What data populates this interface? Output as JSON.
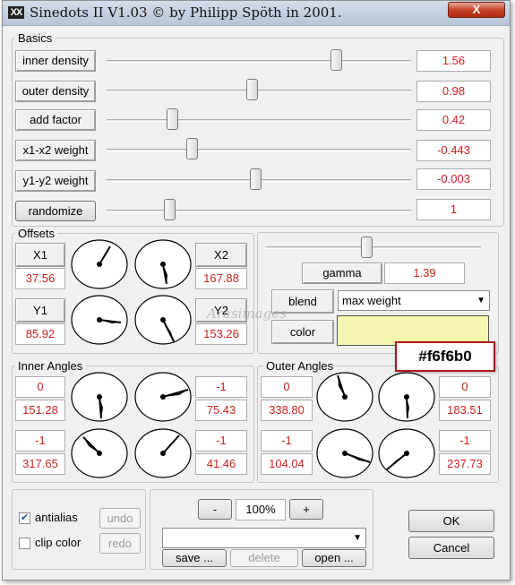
{
  "window": {
    "title": "Sinedots II V1.03 © by Philipp Spöth in 2001.",
    "close_label": "X",
    "icon_glyph": "XX"
  },
  "basics": {
    "group_label": "Basics",
    "rows": [
      {
        "label": "inner density",
        "value": "1.56",
        "slider": 0.82
      },
      {
        "label": "outer density",
        "value": "0.98",
        "slider": 0.55
      },
      {
        "label": "add factor",
        "value": "0.42",
        "slider": 0.23
      },
      {
        "label": "x1-x2 weight",
        "value": "-0.443",
        "slider": 0.3
      },
      {
        "label": "y1-y2 weight",
        "value": "-0.003",
        "slider": 0.53
      },
      {
        "label": "randomize",
        "value": "1",
        "slider": 0.22
      }
    ]
  },
  "offsets": {
    "group_label": "Offsets",
    "x1": {
      "label": "X1",
      "value": "37.56"
    },
    "x2": {
      "label": "X2",
      "value": "167.88"
    },
    "y1": {
      "label": "Y1",
      "value": "85.92"
    },
    "y2": {
      "label": "Y2",
      "value": "153.26"
    }
  },
  "gamma": {
    "label": "gamma",
    "value": "1.39",
    "slider": 0.46
  },
  "blend": {
    "label": "blend",
    "selected": "max weight"
  },
  "color": {
    "label": "color",
    "hex": "#f6f6b0",
    "tooltip": "#f6f6b0"
  },
  "inner_angles": {
    "group_label": "Inner Angles",
    "rows": [
      {
        "left_top": "0",
        "left_bottom": "151.28",
        "right_top": "-1",
        "right_bottom": "75.43"
      },
      {
        "left_top": "-1",
        "left_bottom": "317.65",
        "right_top": "-1",
        "right_bottom": "41.46"
      }
    ]
  },
  "outer_angles": {
    "group_label": "Outer Angles",
    "rows": [
      {
        "left_top": "0",
        "left_bottom": "338.80",
        "right_top": "0",
        "right_bottom": "183.51"
      },
      {
        "left_top": "-1",
        "left_bottom": "104.04",
        "right_top": "-1",
        "right_bottom": "237.73"
      }
    ]
  },
  "options": {
    "antialias": {
      "label": "antialias",
      "checked": true
    },
    "clip_color": {
      "label": "clip color",
      "checked": false
    },
    "undo_label": "undo",
    "redo_label": "redo"
  },
  "zoom": {
    "minus_label": "-",
    "value": "100%",
    "plus_label": "+"
  },
  "presets": {
    "selected": "",
    "save_label": "save ...",
    "delete_label": "delete",
    "open_label": "open ..."
  },
  "dialog": {
    "ok_label": "OK",
    "cancel_label": "Cancel"
  },
  "watermark": "Arasimages",
  "colors": {
    "value_text": "#d02020",
    "window_bg": "#f0f0f0",
    "title_gradient_top": "#d4dde9",
    "close_red": "#c7432c"
  }
}
